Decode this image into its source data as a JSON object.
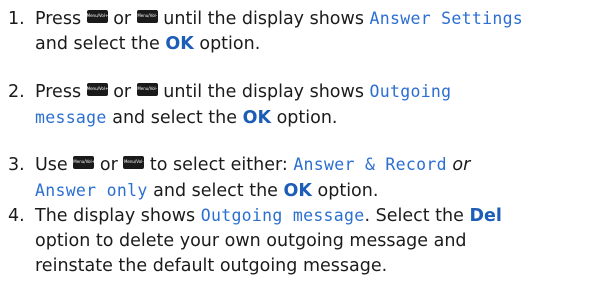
{
  "steps": [
    {
      "number": "1.",
      "lines": [
        {
          "a": "Press",
          "key1": "Menu/Vol+",
          "b": "or",
          "key2": "Menu/Vol-",
          "c": "until the display shows",
          "lcd": "Answer Settings"
        },
        {
          "a": "and select the",
          "opt": "OK",
          "b": "option."
        }
      ]
    },
    {
      "number": "2.",
      "lines": [
        {
          "a": "Press",
          "key1": "Menu/Vol+",
          "b": "or",
          "key2": "Menu/Vol-",
          "c": "until the display shows",
          "lcd": "Outgoing"
        },
        {
          "lcd": "message",
          "a": "and select the",
          "opt": "OK",
          "b": "option."
        }
      ]
    },
    {
      "number": "3.",
      "lines": [
        {
          "a": "Use",
          "key1": "Menu/Vol+",
          "b": "or",
          "key2": "Menu/Vol-",
          "c": "to select either:",
          "lcd": "Answer & Record",
          "d": "or"
        },
        {
          "lcd": "Answer only",
          "a": "and select the",
          "opt": "OK",
          "b": "option."
        }
      ]
    },
    {
      "number": "4.",
      "lines": [
        {
          "a": "The display shows",
          "lcd": "Outgoing message",
          "b": ". Select the",
          "opt": "Del"
        },
        {
          "a": "option to delete your own outgoing message and"
        },
        {
          "a": "reinstate the default outgoing message."
        }
      ]
    }
  ]
}
